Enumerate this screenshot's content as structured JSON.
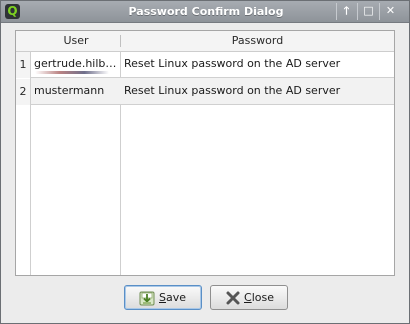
{
  "window": {
    "title": "Password Confirm Dialog",
    "app_icon_glyph": "Q",
    "controls": {
      "up": "🡑",
      "maximize": "□",
      "close": "✕"
    }
  },
  "table": {
    "columns": [
      "User",
      "Password"
    ],
    "rows": [
      {
        "num": "1",
        "user": "gertrude.hilb…",
        "password": "Reset Linux password on the AD server"
      },
      {
        "num": "2",
        "user": "mustermann",
        "password": "Reset Linux password on the AD server"
      }
    ]
  },
  "buttons": {
    "save": {
      "mnemonic": "S",
      "rest": "ave",
      "icon": "save-icon"
    },
    "close": {
      "mnemonic": "C",
      "rest": "lose",
      "icon": "close-x-icon"
    }
  },
  "colors": {
    "titlebar": "#9da2a8",
    "app_icon_accent": "#7ed321",
    "default_button_border": "#5a8fc6",
    "close_x": "#555555"
  }
}
